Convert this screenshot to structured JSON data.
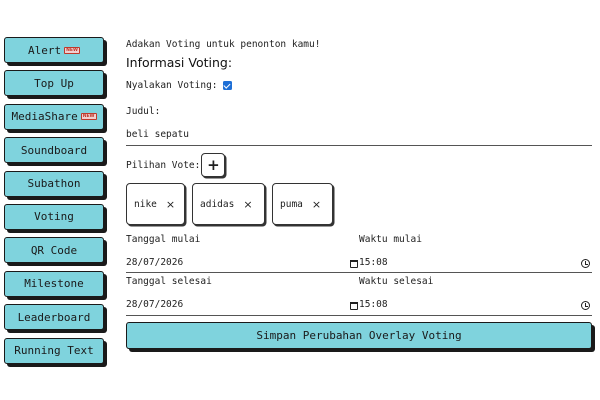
{
  "sidebar": {
    "items": [
      {
        "label": "Alert",
        "badge": "NEW"
      },
      {
        "label": "Top Up"
      },
      {
        "label": "MediaShare",
        "badge": "NEW"
      },
      {
        "label": "Soundboard"
      },
      {
        "label": "Subathon"
      },
      {
        "label": "Voting"
      },
      {
        "label": "QR Code"
      },
      {
        "label": "Milestone"
      },
      {
        "label": "Leaderboard"
      },
      {
        "label": "Running Text"
      }
    ]
  },
  "main": {
    "intro": "Adakan Voting untuk penonton kamu!",
    "heading": "Informasi Voting:",
    "enable_label": "Nyalakan Voting:",
    "enable_checked": true,
    "title_label": "Judul:",
    "title_value": "beli sepatu",
    "options_label": "Pilihan Vote:",
    "add_icon": "+",
    "options": [
      {
        "label": "nike",
        "remove": "×"
      },
      {
        "label": "adidas",
        "remove": "×"
      },
      {
        "label": "puma",
        "remove": "×"
      }
    ],
    "start_date_label": "Tanggal mulai",
    "start_date": "28/07/2026",
    "start_time_label": "Waktu mulai",
    "start_time": "15:08",
    "end_date_label": "Tanggal selesai",
    "end_date": "28/07/2026",
    "end_time_label": "Waktu selesai",
    "end_time": "15:08",
    "save_label": "Simpan Perubahan Overlay Voting"
  },
  "colors": {
    "accent": "#7fd3dd",
    "checkbox": "#1e6fd6",
    "badge": "#c0392b"
  }
}
